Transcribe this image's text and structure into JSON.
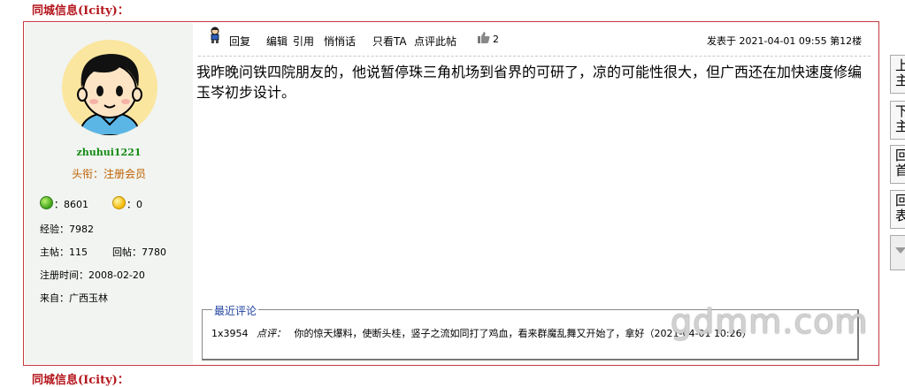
{
  "header": {
    "title": "同城信息(Icity)："
  },
  "user": {
    "name": "zhuhui1221",
    "rank": "头衔：注册会员",
    "points_green": "：8601",
    "points_yellow": "：0",
    "exp": "经验：7982",
    "threads": "主帖：115",
    "replies": "回帖：7780",
    "registered": "注册时间：2008-02-20",
    "from": "来自：广西玉林"
  },
  "toolbar": {
    "reply": "回复",
    "edit": "编辑",
    "quote": "引用",
    "whisper": "悄悄话",
    "only_ta": "只看TA",
    "rate": "点评此帖",
    "likes": "2",
    "posted": "发表于 2021-04-01 09:55 第12楼"
  },
  "post": {
    "text": "我昨晚问铁四院朋友的，他说暂停珠三角机场到省界的可研了，凉的可能性很大，但广西还在加快速度修编玉岑初步设计。"
  },
  "comments": {
    "title": "最近评论",
    "items": [
      {
        "user": "1x3954",
        "verb": "点评：",
        "text": "你的惊天爆料，使断头桂，竖子之流如同打了鸡血，看来群魔乱舞又开始了，拿好",
        "time": "（2021-04-01 10:26）"
      }
    ]
  },
  "watermark": "gdmm.com",
  "side_nav": [
    "上主",
    "下主",
    "回首",
    "回表"
  ],
  "bottom_partial": "同城信息(Icity)："
}
